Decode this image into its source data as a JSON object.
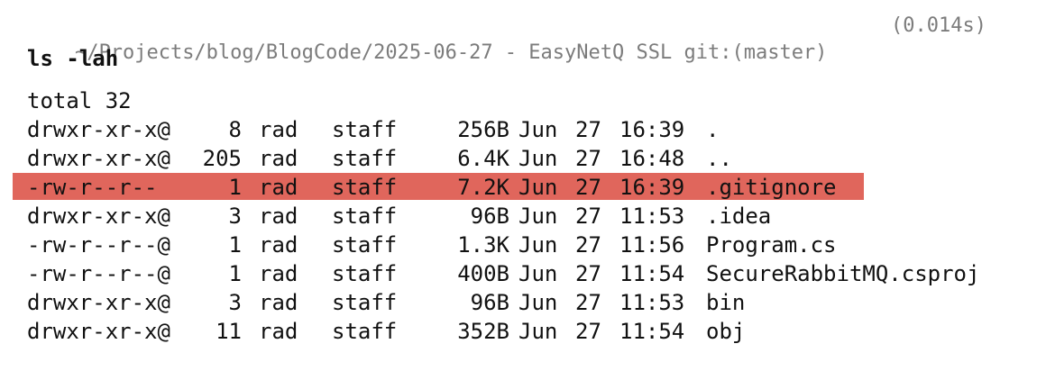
{
  "terminal": {
    "prompt_path": "~/Projects/blog/BlogCode/2025-06-27 - EasyNetQ SSL git:(master)",
    "prompt_time": "(0.014s)",
    "command": "ls -lah"
  },
  "listing": {
    "total": "total 32",
    "rows": [
      {
        "perm": "drwxr-xr-x@",
        "links": "8",
        "owner": "rad",
        "group": "staff",
        "size": "256B",
        "month": "Jun",
        "day": "27",
        "time": "16:39",
        "name": "."
      },
      {
        "perm": "drwxr-xr-x@",
        "links": "205",
        "owner": "rad",
        "group": "staff",
        "size": "6.4K",
        "month": "Jun",
        "day": "27",
        "time": "16:48",
        "name": ".."
      },
      {
        "perm": "-rw-r--r--",
        "links": "1",
        "owner": "rad",
        "group": "staff",
        "size": "7.2K",
        "month": "Jun",
        "day": "27",
        "time": "16:39",
        "name": ".gitignore",
        "highlighted": true
      },
      {
        "perm": "drwxr-xr-x@",
        "links": "3",
        "owner": "rad",
        "group": "staff",
        "size": "96B",
        "month": "Jun",
        "day": "27",
        "time": "11:53",
        "name": ".idea"
      },
      {
        "perm": "-rw-r--r--@",
        "links": "1",
        "owner": "rad",
        "group": "staff",
        "size": "1.3K",
        "month": "Jun",
        "day": "27",
        "time": "11:56",
        "name": "Program.cs"
      },
      {
        "perm": "-rw-r--r--@",
        "links": "1",
        "owner": "rad",
        "group": "staff",
        "size": "400B",
        "month": "Jun",
        "day": "27",
        "time": "11:54",
        "name": "SecureRabbitMQ.csproj"
      },
      {
        "perm": "drwxr-xr-x@",
        "links": "3",
        "owner": "rad",
        "group": "staff",
        "size": "96B",
        "month": "Jun",
        "day": "27",
        "time": "11:53",
        "name": "bin"
      },
      {
        "perm": "drwxr-xr-x@",
        "links": "11",
        "owner": "rad",
        "group": "staff",
        "size": "352B",
        "month": "Jun",
        "day": "27",
        "time": "11:54",
        "name": "obj"
      }
    ]
  },
  "colors": {
    "highlight": "#e0665c",
    "prompt_text": "#7c7c7c",
    "text": "#111111",
    "background": "#ffffff"
  }
}
